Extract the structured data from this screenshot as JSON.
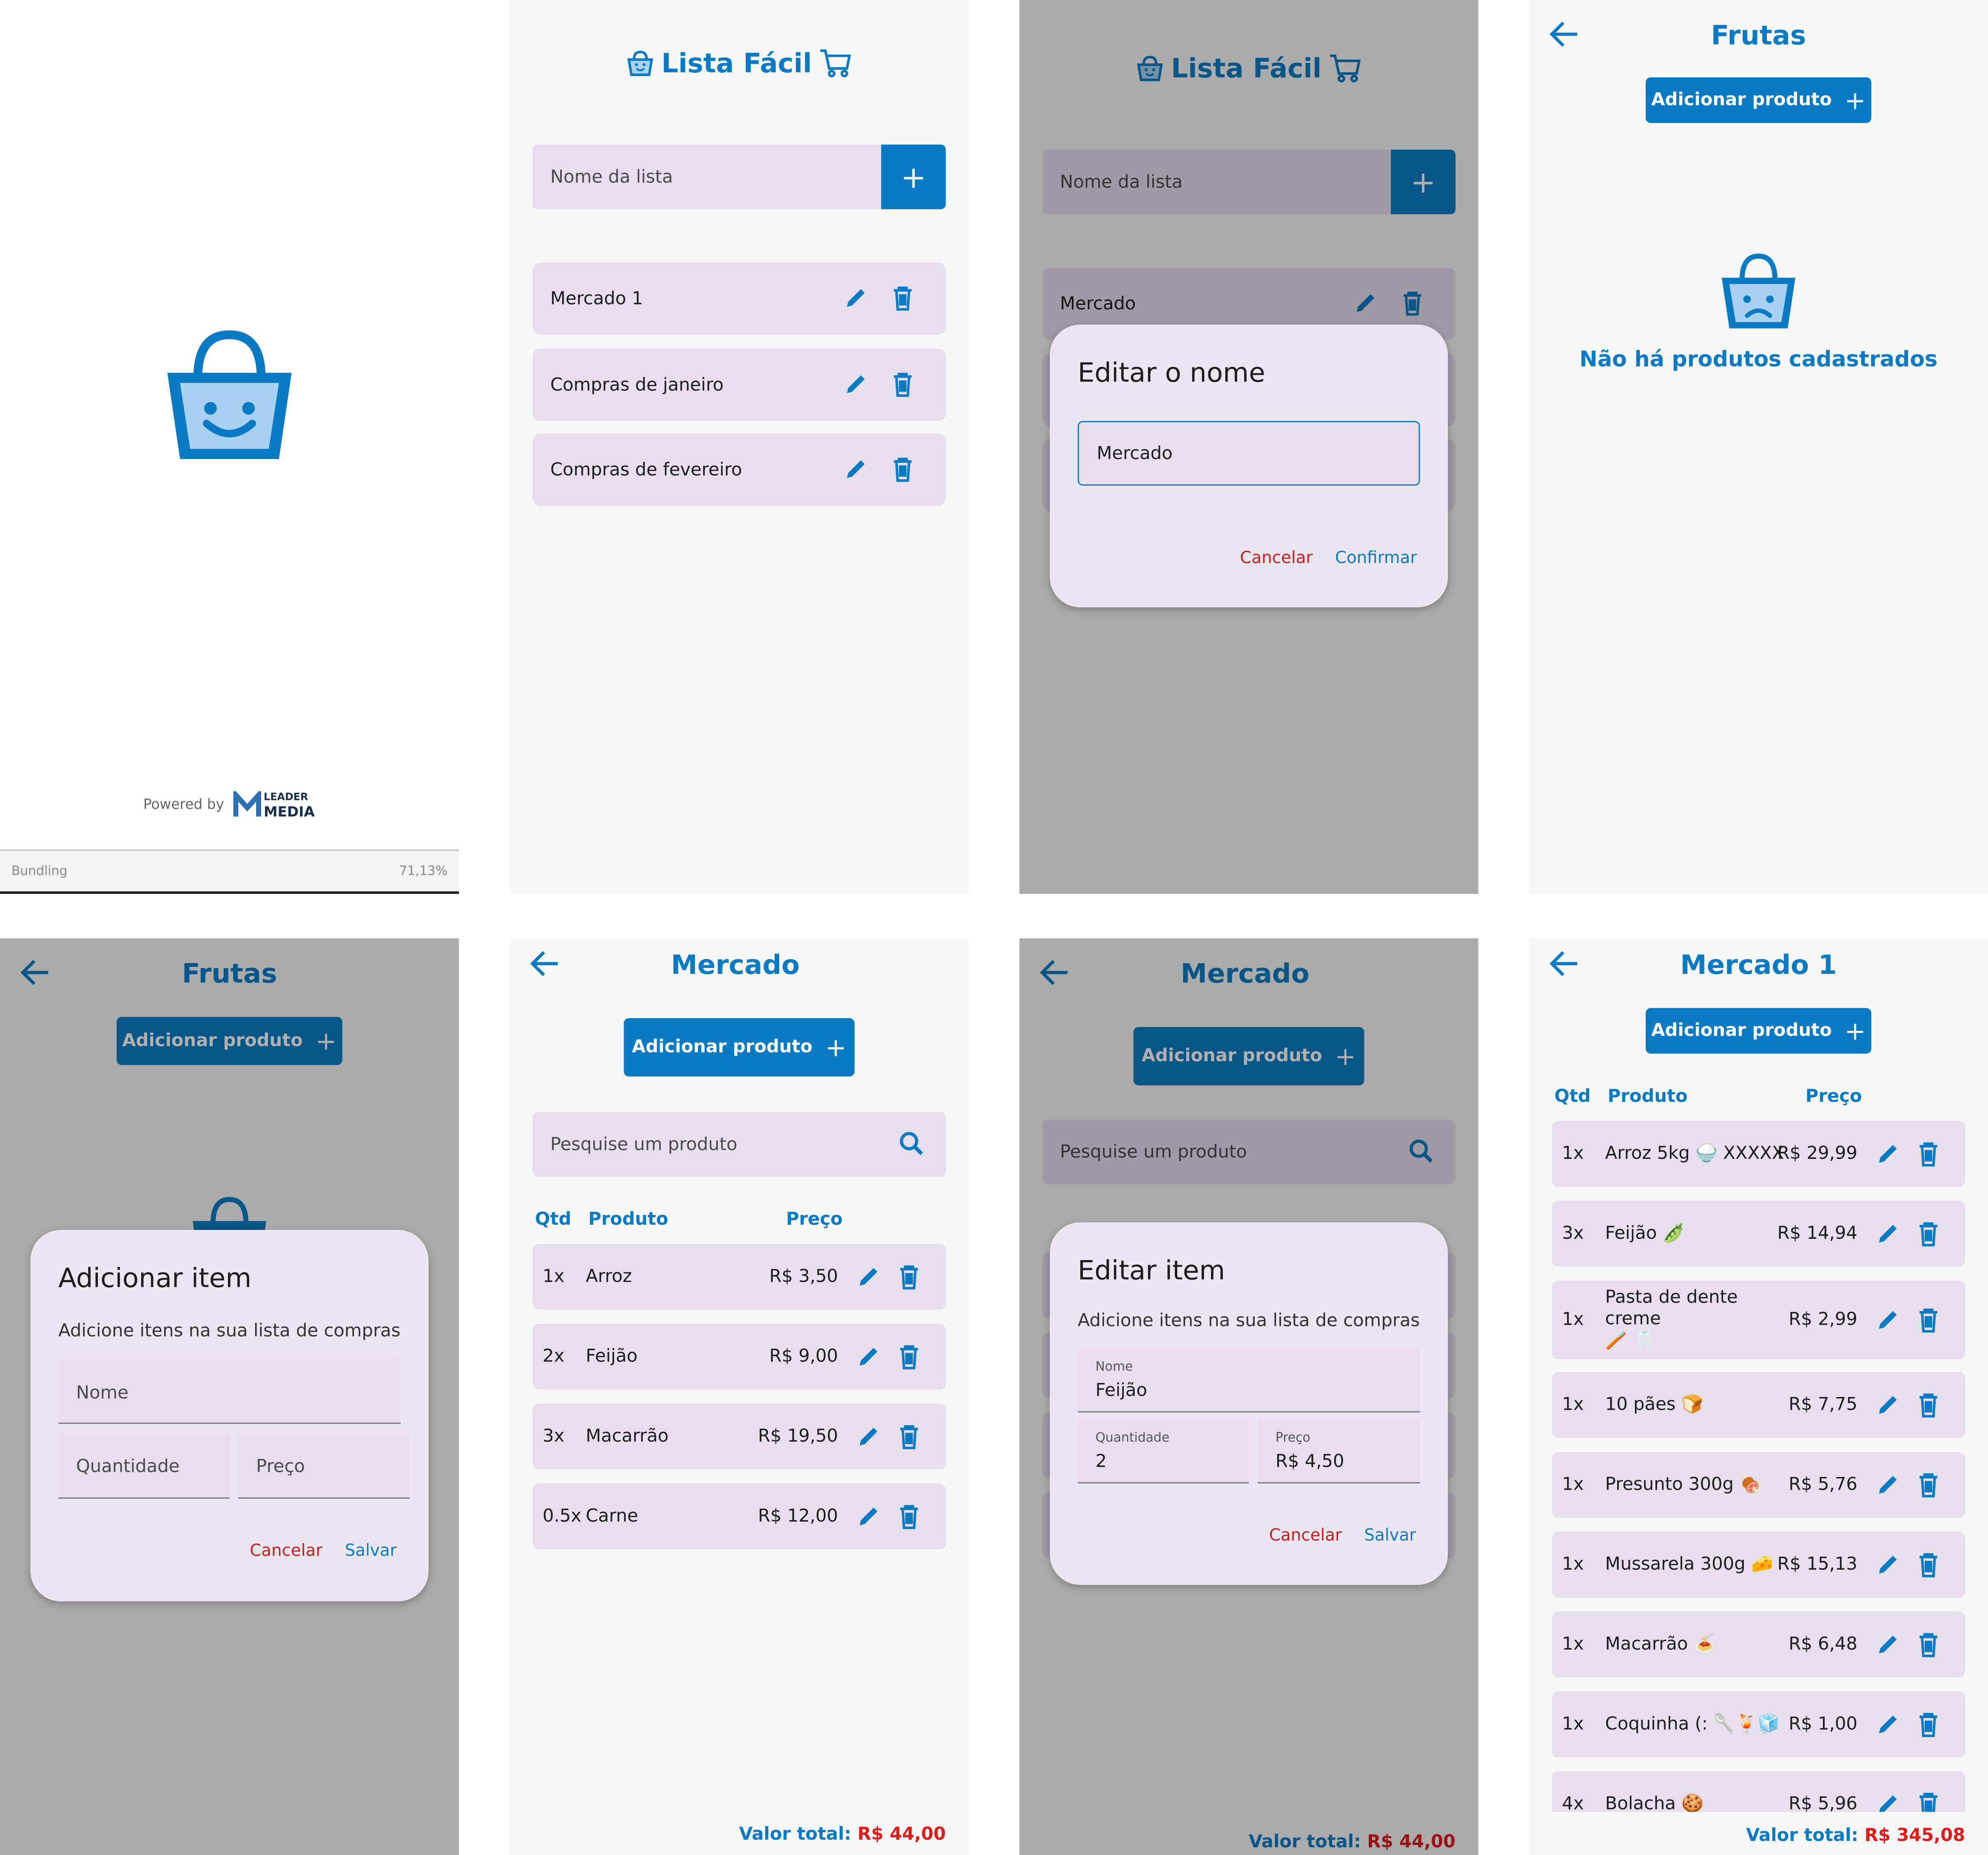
{
  "colors": {
    "primary": "#0b7ac4",
    "danger": "#e01b1b",
    "surface": "#e7e0ec",
    "dialog": "#ece6f0"
  },
  "splash": {
    "powered_by": "Powered by",
    "brand_top": "LEADER",
    "brand_bottom": "MEDIA",
    "bundling_label": "Bundling",
    "bundling_progress": "71,13%"
  },
  "home": {
    "title": "Lista Fácil",
    "input_placeholder": "Nome da lista",
    "lists": [
      "Mercado 1",
      "Compras de janeiro",
      "Compras de fevereiro"
    ]
  },
  "edit_name": {
    "title": "Lista Fácil",
    "input_placeholder": "Nome da lista",
    "bg_item": "Mercado",
    "dialog_title": "Editar o nome",
    "field_value": "Mercado",
    "cancel": "Cancelar",
    "confirm": "Confirmar"
  },
  "empty": {
    "title": "Frutas",
    "add_button": "Adicionar produto",
    "empty_message": "Não há produtos cadastrados"
  },
  "add_item": {
    "title": "Frutas",
    "add_button": "Adicionar produto",
    "dialog_title": "Adicionar item",
    "dialog_subtitle": "Adicione itens na sua lista de compras",
    "name_placeholder": "Nome",
    "qty_placeholder": "Quantidade",
    "price_placeholder": "Preço",
    "cancel": "Cancelar",
    "save": "Salvar"
  },
  "mercado": {
    "title": "Mercado",
    "add_button": "Adicionar produto",
    "search_placeholder": "Pesquise um produto",
    "headers": {
      "qty": "Qtd",
      "product": "Produto",
      "price": "Preço"
    },
    "items": [
      {
        "qty": "1x",
        "name": "Arroz",
        "price": "R$ 3,50"
      },
      {
        "qty": "2x",
        "name": "Feijão",
        "price": "R$ 9,00"
      },
      {
        "qty": "3x",
        "name": "Macarrão",
        "price": "R$ 19,50"
      },
      {
        "qty": "0.5x",
        "name": "Carne",
        "price": "R$ 12,00"
      }
    ],
    "total_label": "Valor total:",
    "total_value": "R$ 44,00"
  },
  "edit_item": {
    "title": "Mercado",
    "add_button": "Adicionar produto",
    "search_placeholder": "Pesquise um produto",
    "dialog_title": "Editar item",
    "dialog_subtitle": "Adicione itens na sua lista de compras",
    "name_label": "Nome",
    "name_value": "Feijão",
    "qty_label": "Quantidade",
    "qty_value": "2",
    "price_label": "Preço",
    "price_value": "R$ 4,50",
    "cancel": "Cancelar",
    "save": "Salvar",
    "total_label": "Valor total:",
    "total_value": "R$ 44,00"
  },
  "mercado1": {
    "title": "Mercado 1",
    "add_button": "Adicionar produto",
    "headers": {
      "qty": "Qtd",
      "product": "Produto",
      "price": "Preço"
    },
    "items": [
      {
        "qty": "1x",
        "name": "Arroz 5kg 🍚 XXXXX",
        "price": "R$ 29,99"
      },
      {
        "qty": "3x",
        "name": "Feijão 🫛",
        "price": "R$ 14,94"
      },
      {
        "qty": "1x",
        "name": "Pasta de dente creme",
        "name2": "🪥 🦷",
        "price": "R$ 2,99"
      },
      {
        "qty": "1x",
        "name": "10 pães 🍞",
        "price": "R$ 7,75"
      },
      {
        "qty": "1x",
        "name": "Presunto 300g 🍖",
        "price": "R$ 5,76"
      },
      {
        "qty": "1x",
        "name": "Mussarela 300g 🧀",
        "price": "R$ 15,13"
      },
      {
        "qty": "1x",
        "name": "Macarrão 🍝",
        "price": "R$ 6,48"
      },
      {
        "qty": "1x",
        "name": "Coquinha (: 🥄🍹🧊",
        "price": "R$ 1,00"
      },
      {
        "qty": "4x",
        "name": "Bolacha 🍪",
        "price": "R$ 5,96"
      }
    ],
    "total_label": "Valor total:",
    "total_value": "R$ 345,08"
  }
}
